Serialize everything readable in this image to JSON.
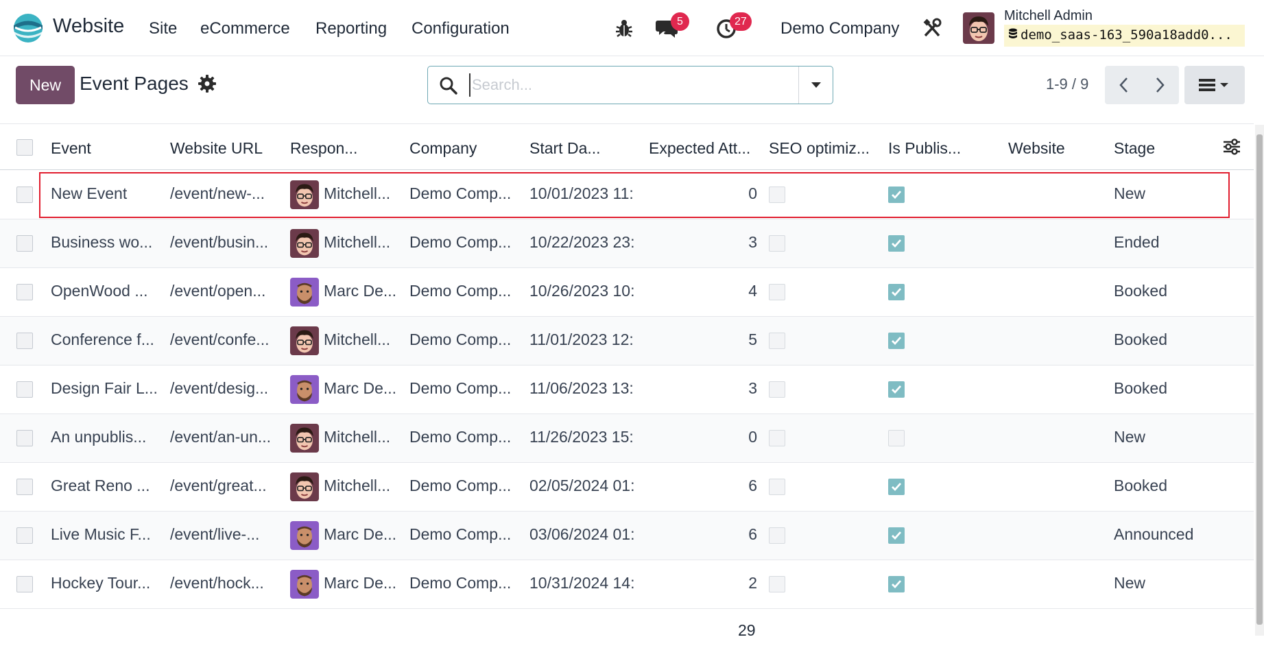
{
  "navbar": {
    "app_name": "Website",
    "menu": [
      "Site",
      "eCommerce",
      "Reporting",
      "Configuration"
    ],
    "messages_count": "5",
    "activities_count": "27",
    "company": "Demo Company",
    "user_name": "Mitchell Admin",
    "database": "demo_saas-163_590a18add0..."
  },
  "control": {
    "new_label": "New",
    "title": "Event Pages",
    "search_placeholder": "Search...",
    "pager": "1-9 / 9"
  },
  "table": {
    "columns": [
      "Event",
      "Website URL",
      "Respon...",
      "Company",
      "Start Da...",
      "Expected Att...",
      "SEO optimiz...",
      "Is Publis...",
      "Website",
      "Stage"
    ],
    "rows": [
      {
        "event": "New Event",
        "url": "/event/new-...",
        "responsible": "Mitchell...",
        "avatar": "mitchell",
        "company": "Demo Comp...",
        "start": "10/01/2023 11:",
        "expected": "0",
        "seo": false,
        "published": true,
        "website": "",
        "stage": "New"
      },
      {
        "event": "Business wo...",
        "url": "/event/busin...",
        "responsible": "Mitchell...",
        "avatar": "mitchell",
        "company": "Demo Comp...",
        "start": "10/22/2023 23:",
        "expected": "3",
        "seo": false,
        "published": true,
        "website": "",
        "stage": "Ended"
      },
      {
        "event": "OpenWood ...",
        "url": "/event/open...",
        "responsible": "Marc De...",
        "avatar": "marc",
        "company": "Demo Comp...",
        "start": "10/26/2023 10:",
        "expected": "4",
        "seo": false,
        "published": true,
        "website": "",
        "stage": "Booked"
      },
      {
        "event": "Conference f...",
        "url": "/event/confe...",
        "responsible": "Mitchell...",
        "avatar": "mitchell",
        "company": "Demo Comp...",
        "start": "11/01/2023 12:",
        "expected": "5",
        "seo": false,
        "published": true,
        "website": "",
        "stage": "Booked"
      },
      {
        "event": "Design Fair L...",
        "url": "/event/desig...",
        "responsible": "Marc De...",
        "avatar": "marc",
        "company": "Demo Comp...",
        "start": "11/06/2023 13:",
        "expected": "3",
        "seo": false,
        "published": true,
        "website": "",
        "stage": "Booked"
      },
      {
        "event": "An unpublis...",
        "url": "/event/an-un...",
        "responsible": "Mitchell...",
        "avatar": "mitchell",
        "company": "Demo Comp...",
        "start": "11/26/2023 15:",
        "expected": "0",
        "seo": false,
        "published": false,
        "website": "",
        "stage": "New"
      },
      {
        "event": "Great Reno ...",
        "url": "/event/great...",
        "responsible": "Mitchell...",
        "avatar": "mitchell",
        "company": "Demo Comp...",
        "start": "02/05/2024 01:",
        "expected": "6",
        "seo": false,
        "published": true,
        "website": "",
        "stage": "Booked"
      },
      {
        "event": "Live Music F...",
        "url": "/event/live-...",
        "responsible": "Marc De...",
        "avatar": "marc",
        "company": "Demo Comp...",
        "start": "03/06/2024 01:",
        "expected": "6",
        "seo": false,
        "published": true,
        "website": "",
        "stage": "Announced"
      },
      {
        "event": "Hockey Tour...",
        "url": "/event/hock...",
        "responsible": "Marc De...",
        "avatar": "marc",
        "company": "Demo Comp...",
        "start": "10/31/2024 14:",
        "expected": "2",
        "seo": false,
        "published": true,
        "website": "",
        "stage": "New"
      }
    ],
    "total_expected": "29"
  },
  "colors": {
    "brand": "#714b67",
    "badge": "#e0284f",
    "checked": "#7fbcc3",
    "highlight": "#e11d2e"
  }
}
